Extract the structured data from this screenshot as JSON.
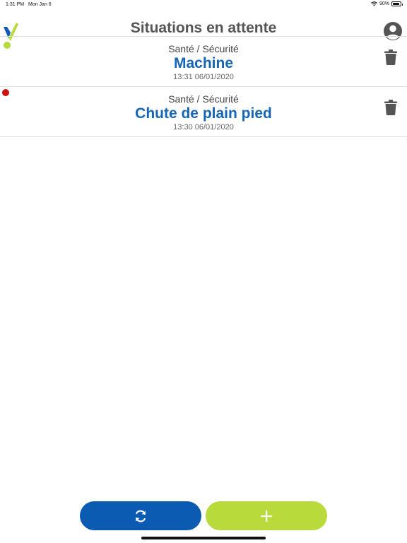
{
  "status_bar": {
    "time": "1:31 PM",
    "date": "Mon Jan 6",
    "battery": "90%",
    "battery_level": 0.9
  },
  "header": {
    "title": "Situations en attente"
  },
  "items": [
    {
      "category": "Santé / Sécurité",
      "title": "Machine",
      "datetime": "13:31 06/01/2020",
      "flagged": false
    },
    {
      "category": "Santé / Sécurité",
      "title": "Chute de plain pied",
      "datetime": "13:30 06/01/2020",
      "flagged": true
    }
  ],
  "icons": {
    "logo": "logo-icon",
    "profile": "user-icon",
    "delete": "trash-icon",
    "sync": "sync-icon",
    "add": "plus-icon",
    "wifi": "wifi-icon",
    "battery": "battery-icon"
  },
  "colors": {
    "primary_blue": "#0b5bb3",
    "title_blue": "#1565b5",
    "accent_green": "#b8da3b",
    "status_red": "#cc1111",
    "icon_gray": "#555555"
  }
}
